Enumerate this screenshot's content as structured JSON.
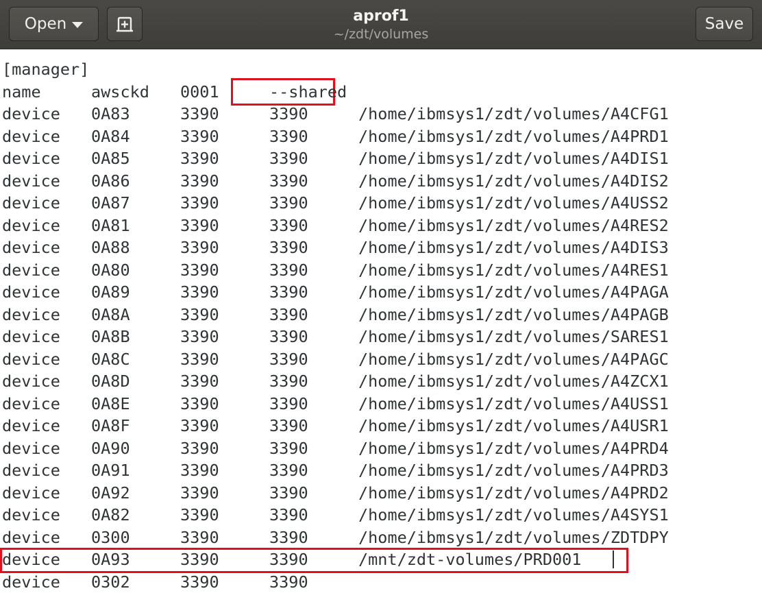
{
  "header": {
    "open_label": "Open",
    "save_label": "Save",
    "title": "aprof1",
    "subtitle": "~/zdt/volumes"
  },
  "editor": {
    "lines": [
      [
        "[manager]",
        "",
        "",
        "",
        ""
      ],
      [
        "name",
        "awsckd",
        "0001",
        "--shared",
        ""
      ],
      [
        "device",
        "0A83",
        "3390",
        "3390",
        "/home/ibmsys1/zdt/volumes/A4CFG1"
      ],
      [
        "device",
        "0A84",
        "3390",
        "3390",
        "/home/ibmsys1/zdt/volumes/A4PRD1"
      ],
      [
        "device",
        "0A85",
        "3390",
        "3390",
        "/home/ibmsys1/zdt/volumes/A4DIS1"
      ],
      [
        "device",
        "0A86",
        "3390",
        "3390",
        "/home/ibmsys1/zdt/volumes/A4DIS2"
      ],
      [
        "device",
        "0A87",
        "3390",
        "3390",
        "/home/ibmsys1/zdt/volumes/A4USS2"
      ],
      [
        "device",
        "0A81",
        "3390",
        "3390",
        "/home/ibmsys1/zdt/volumes/A4RES2"
      ],
      [
        "device",
        "0A88",
        "3390",
        "3390",
        "/home/ibmsys1/zdt/volumes/A4DIS3"
      ],
      [
        "device",
        "0A80",
        "3390",
        "3390",
        "/home/ibmsys1/zdt/volumes/A4RES1"
      ],
      [
        "device",
        "0A89",
        "3390",
        "3390",
        "/home/ibmsys1/zdt/volumes/A4PAGA"
      ],
      [
        "device",
        "0A8A",
        "3390",
        "3390",
        "/home/ibmsys1/zdt/volumes/A4PAGB"
      ],
      [
        "device",
        "0A8B",
        "3390",
        "3390",
        "/home/ibmsys1/zdt/volumes/SARES1"
      ],
      [
        "device",
        "0A8C",
        "3390",
        "3390",
        "/home/ibmsys1/zdt/volumes/A4PAGC"
      ],
      [
        "device",
        "0A8D",
        "3390",
        "3390",
        "/home/ibmsys1/zdt/volumes/A4ZCX1"
      ],
      [
        "device",
        "0A8E",
        "3390",
        "3390",
        "/home/ibmsys1/zdt/volumes/A4USS1"
      ],
      [
        "device",
        "0A8F",
        "3390",
        "3390",
        "/home/ibmsys1/zdt/volumes/A4USR1"
      ],
      [
        "device",
        "0A90",
        "3390",
        "3390",
        "/home/ibmsys1/zdt/volumes/A4PRD4"
      ],
      [
        "device",
        "0A91",
        "3390",
        "3390",
        "/home/ibmsys1/zdt/volumes/A4PRD3"
      ],
      [
        "device",
        "0A92",
        "3390",
        "3390",
        "/home/ibmsys1/zdt/volumes/A4PRD2"
      ],
      [
        "device",
        "0A82",
        "3390",
        "3390",
        "/home/ibmsys1/zdt/volumes/A4SYS1"
      ],
      [
        "device",
        "0300",
        "3390",
        "3390",
        "/home/ibmsys1/zdt/volumes/ZDTDPY"
      ],
      [
        "device",
        "0A93",
        "3390",
        "3390",
        "/mnt/zdt-volumes/PRD001"
      ],
      [
        "device",
        "0302",
        "3390",
        "3390",
        ""
      ]
    ]
  },
  "colors": {
    "highlight": "#e0101e",
    "headerbar": "#42413d",
    "text": "#2e3436"
  },
  "icons": {
    "new_tab": "new-tab-icon",
    "open_dropdown": "chevron-down-icon"
  }
}
